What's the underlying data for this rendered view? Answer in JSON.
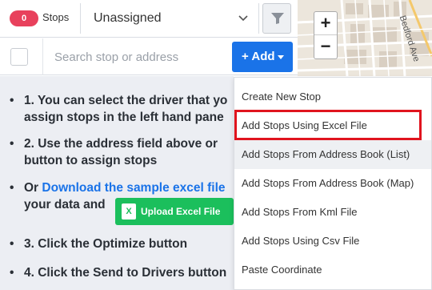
{
  "topbar": {
    "stops_count": "0",
    "stops_label": "Stops",
    "driver_value": "Unassigned"
  },
  "search": {
    "placeholder": "Search stop or address",
    "add_label": "+ Add"
  },
  "map": {
    "zoom_in": "+",
    "zoom_out": "−",
    "street_label": "Bedford Ave"
  },
  "instructions": {
    "step1_line1": "1. You can select the driver that yo",
    "step1_line2": "assign stops in the left hand pane",
    "step2_line1": "2. Use the address field above or",
    "step2_line2": "button to assign stops",
    "or_prefix": "Or ",
    "download_link": "Download the sample excel file",
    "step_line_data": "your data and",
    "upload_button": "Upload Excel File",
    "step3": "3. Click the Optimize button",
    "step4": "4. Click the Send to Drivers button"
  },
  "dropdown": {
    "items": [
      "Create New Stop",
      "Add Stops Using Excel File",
      "Add Stops From Address Book (List)",
      "Add Stops From Address Book (Map)",
      "Add Stops From Kml File",
      "Add Stops Using Csv File",
      "Paste Coordinate"
    ]
  }
}
